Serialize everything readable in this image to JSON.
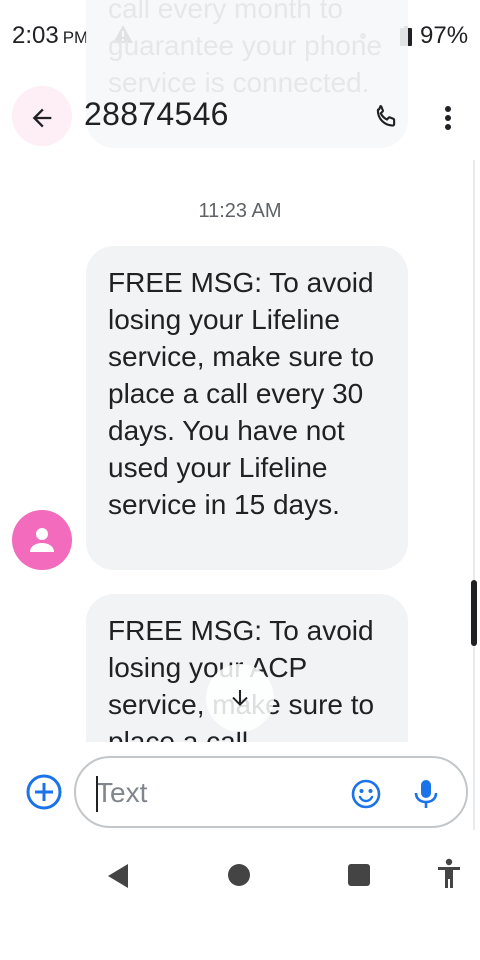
{
  "status_bar": {
    "time": "2:03",
    "ampm": "PM",
    "battery": "97%"
  },
  "ghost_message": {
    "text": "call every month to guarantee your phone service is connected."
  },
  "app_bar": {
    "title": "28874546",
    "back_icon": "arrow-left-icon",
    "call_icon": "phone-icon",
    "more_icon": "more-vert-icon"
  },
  "conversation": {
    "timestamp": "11:23 AM",
    "messages": [
      {
        "text": "FREE MSG: To avoid losing your Lifeline service, make sure to place a call every 30 days. You have not used your Lifeline service in 15 days."
      },
      {
        "text": "FREE MSG: To avoid losing your ACP service, make sure to place a call"
      }
    ],
    "avatar_color": "#f26bbd"
  },
  "composer": {
    "placeholder": "Text",
    "add_icon": "add-circle-icon",
    "emoji_icon": "emoji-icon",
    "mic_icon": "mic-icon",
    "accent": "#1a73e8"
  },
  "nav_bar": {
    "back_icon": "nav-back-icon",
    "home_icon": "nav-home-icon",
    "recents_icon": "nav-recents-icon",
    "accessibility_icon": "accessibility-icon"
  }
}
